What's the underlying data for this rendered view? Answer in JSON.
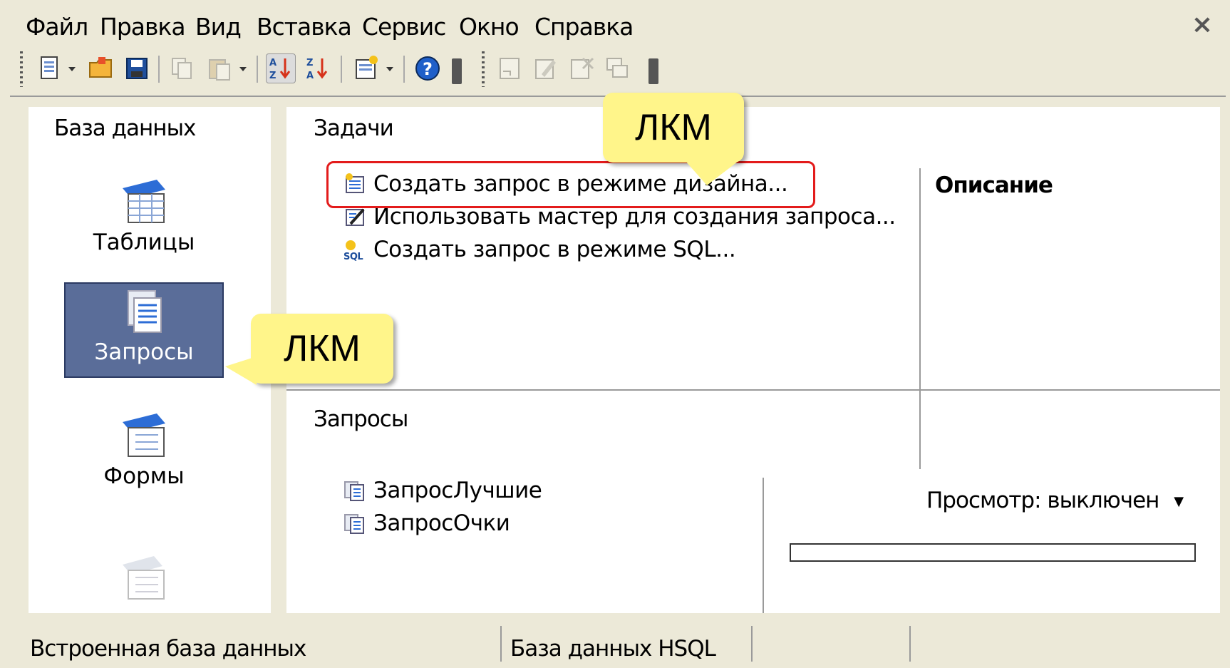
{
  "menu": {
    "items": [
      "Файл",
      "Правка",
      "Вид",
      "Вставка",
      "Сервис",
      "Окно",
      "Справка"
    ],
    "close": "×"
  },
  "toolbar": {
    "icons": [
      "new-document-icon",
      "open-folder-icon",
      "save-icon",
      "copy-icon",
      "paste-icon",
      "sort-ascending-icon",
      "sort-descending-icon",
      "form-wizard-icon",
      "help-icon",
      "open-object-icon",
      "edit-object-icon",
      "delete-object-icon",
      "rename-object-icon"
    ]
  },
  "database_panel": {
    "title": "База данных",
    "items": [
      {
        "label": "Таблицы",
        "selected": false,
        "icon": "tables-icon"
      },
      {
        "label": "Запросы",
        "selected": true,
        "icon": "queries-icon"
      },
      {
        "label": "Формы",
        "selected": false,
        "icon": "forms-icon"
      },
      {
        "label": "",
        "selected": false,
        "icon": "reports-icon"
      }
    ]
  },
  "tasks": {
    "title": "Задачи",
    "items": [
      "Создать запрос в режиме дизайна...",
      "Использовать мастер для создания запроса...",
      "Создать запрос в режиме SQL..."
    ],
    "description_title": "Описание"
  },
  "queries": {
    "title": "Запросы",
    "items": [
      "ЗапросЛучшие",
      "ЗапросОчки"
    ],
    "preview_label": "Просмотр: выключен"
  },
  "statusbar": {
    "embedded": "Встроенная база данных",
    "dbtype": "База данных HSQL"
  },
  "callouts": {
    "top": "ЛКМ",
    "middle": "ЛКМ"
  },
  "colors": {
    "selection": "#5a6d99",
    "callout": "#fff58a",
    "highlight": "#e31b1b"
  }
}
